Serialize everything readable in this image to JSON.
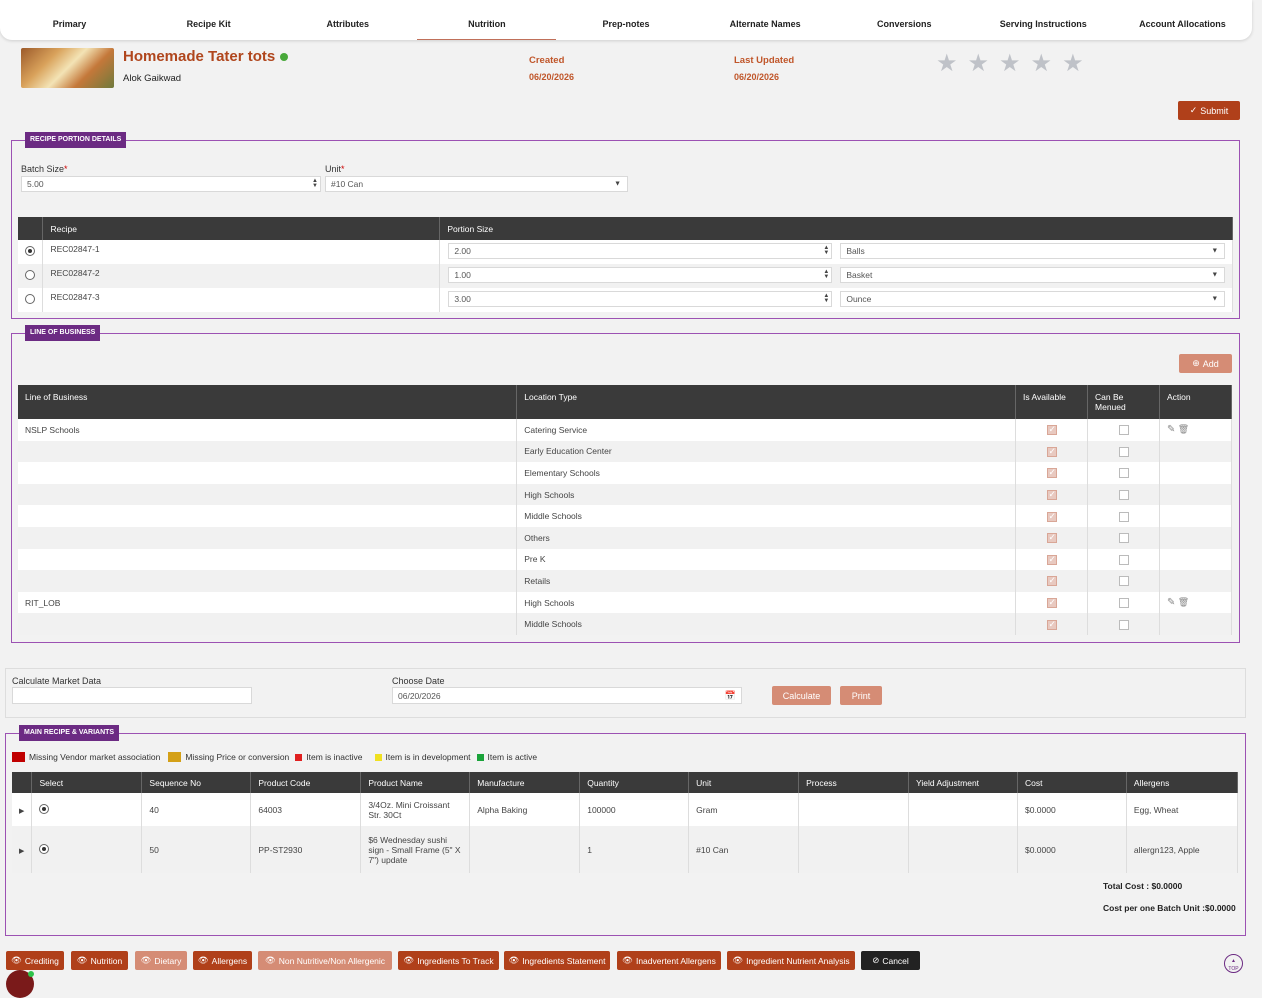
{
  "tabs": [
    "Primary",
    "Recipe Kit",
    "Attributes",
    "Nutrition",
    "Prep-notes",
    "Alternate Names",
    "Conversions",
    "Serving Instructions",
    "Account Allocations"
  ],
  "active_tab": "Nutrition",
  "header": {
    "title": "Homemade Tater tots",
    "author": "Alok Gaikwad",
    "created_label": "Created",
    "created": "06/20/2026",
    "updated_label": "Last Updated",
    "updated": "06/20/2026",
    "status_color": "#48a83a"
  },
  "submit_label": "Submit",
  "portion": {
    "section_title": "RECIPE PORTION DETAILS",
    "batch_label": "Batch Size",
    "batch_value": "5.00",
    "unit_label": "Unit",
    "unit_value": "#10 Can",
    "columns": [
      "Recipe",
      "Portion Size"
    ],
    "rows": [
      {
        "recipe": "REC02847-1",
        "size": "2.00",
        "unit": "Balls",
        "selected": true
      },
      {
        "recipe": "REC02847-2",
        "size": "1.00",
        "unit": "Basket",
        "selected": false
      },
      {
        "recipe": "REC02847-3",
        "size": "3.00",
        "unit": "Ounce",
        "selected": false
      }
    ]
  },
  "lob": {
    "section_title": "LINE OF BUSINESS",
    "add_label": "Add",
    "columns": [
      "Line of Business",
      "Location Type",
      "Is Available",
      "Can Be Menued",
      "Action"
    ],
    "rows": [
      {
        "lob": "NSLP Schools",
        "loc": "Catering Service",
        "actions": true
      },
      {
        "lob": "",
        "loc": "Early Education Center",
        "actions": false
      },
      {
        "lob": "",
        "loc": "Elementary Schools",
        "actions": false
      },
      {
        "lob": "",
        "loc": "High Schools",
        "actions": false
      },
      {
        "lob": "",
        "loc": "Middle Schools",
        "actions": false
      },
      {
        "lob": "",
        "loc": "Others",
        "actions": false
      },
      {
        "lob": "",
        "loc": "Pre K",
        "actions": false
      },
      {
        "lob": "",
        "loc": "Retails",
        "actions": false
      },
      {
        "lob": "RIT_LOB",
        "loc": "High Schools",
        "actions": true
      },
      {
        "lob": "",
        "loc": "Middle Schools",
        "actions": false
      }
    ]
  },
  "market": {
    "calc_label": "Calculate Market Data",
    "calc_value": "",
    "date_label": "Choose Date",
    "date_value": "06/20/2026",
    "calculate_label": "Calculate",
    "print_label": "Print"
  },
  "variants": {
    "section_title": "MAIN RECIPE & VARIANTS",
    "legend": [
      {
        "label": "Missing Vendor market association",
        "color": "#c00000"
      },
      {
        "label": "Missing Price or conversion",
        "color": "#d4a017"
      },
      {
        "label": "Item is inactive",
        "color": "#e02020"
      },
      {
        "label": "Item is in development",
        "color": "#f0e020"
      },
      {
        "label": "Item is active",
        "color": "#1aa33a"
      }
    ],
    "columns": [
      "Select",
      "Sequence No",
      "Product Code",
      "Product Name",
      "Manufacture",
      "Quantity",
      "Unit",
      "Process",
      "Yield Adjustment",
      "Cost",
      "Allergens"
    ],
    "rows": [
      {
        "seq": "40",
        "code": "64003",
        "name": "3/4Oz. Mini Croissant Str. 30Ct",
        "mfr": "Alpha Baking",
        "qty": "100000",
        "unit": "Gram",
        "process": "",
        "yield": "",
        "cost": "$0.0000",
        "allergens": "Egg, Wheat"
      },
      {
        "seq": "50",
        "code": "PP-ST2930",
        "name": "$6 Wednesday sushi sign - Small Frame (5\" X 7\") update",
        "mfr": "",
        "qty": "1",
        "unit": "#10 Can",
        "process": "",
        "yield": "",
        "cost": "$0.0000",
        "allergens": "allergn123, Apple"
      }
    ],
    "total_cost": "Total Cost : $0.0000",
    "cost_per_unit": "Cost per one Batch Unit :$0.0000"
  },
  "bottom_buttons": [
    "Crediting",
    "Nutrition",
    "Dietary",
    "Allergens",
    "Non Nutritive/Non Allergenic",
    "Ingredients To Track",
    "Ingredients Statement",
    "Inadvertent Allergens",
    "Ingredient Nutrient Analysis"
  ],
  "cancel_label": "Cancel",
  "top_label": "TOP",
  "rating": 0
}
